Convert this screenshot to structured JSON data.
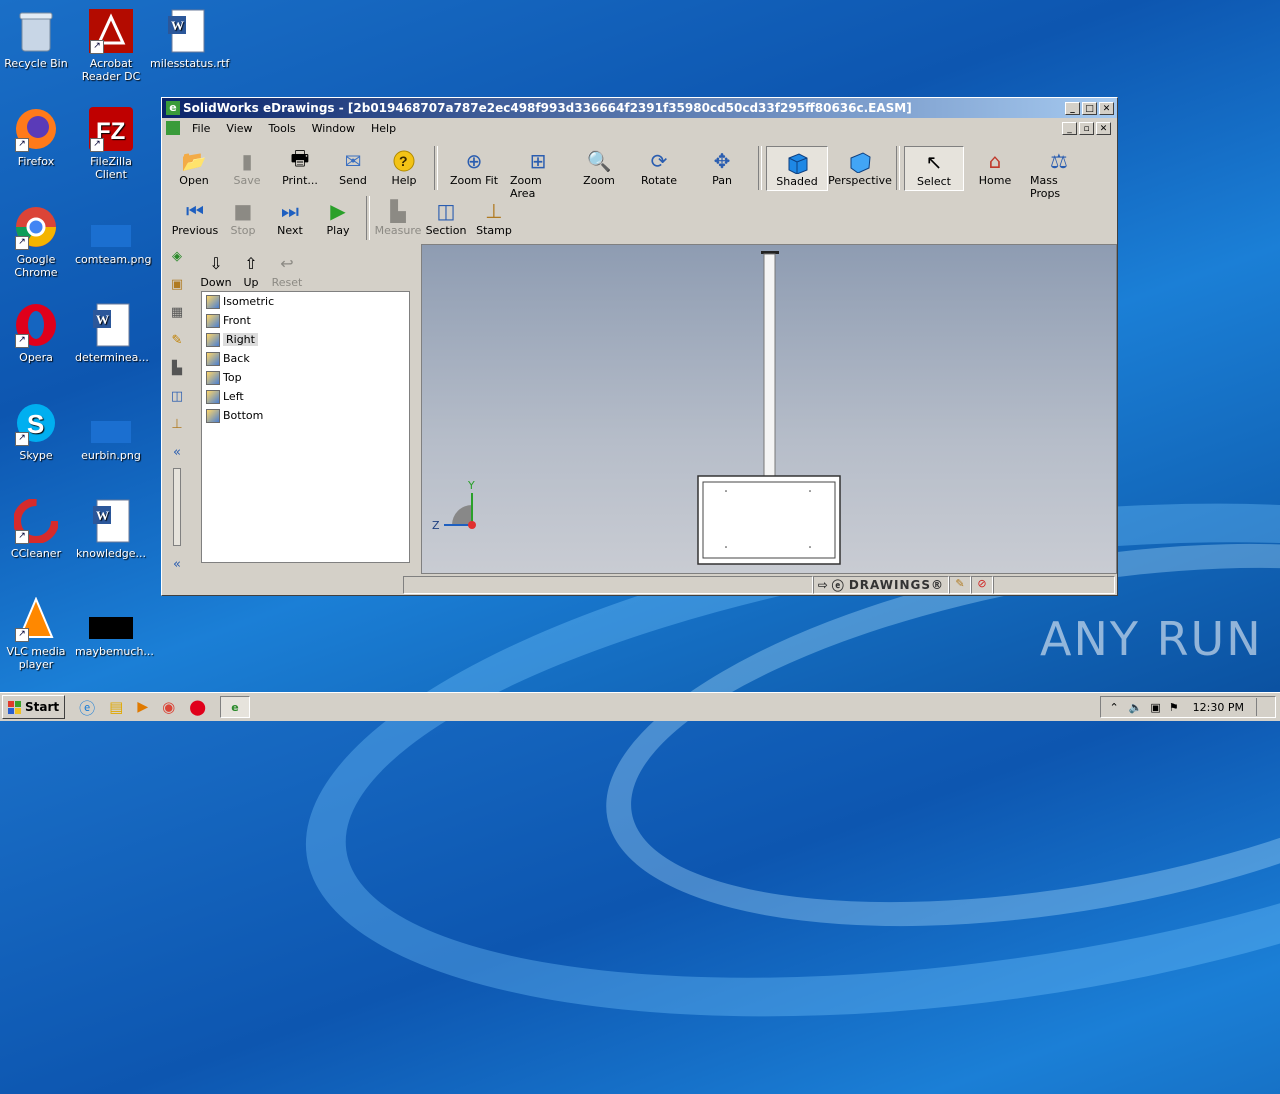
{
  "desktop": {
    "icons": [
      {
        "label": "Recycle Bin"
      },
      {
        "label": "Acrobat Reader DC"
      },
      {
        "label": "milesstatus.rtf"
      },
      {
        "label": "Firefox"
      },
      {
        "label": "FileZilla Client"
      },
      {
        "label": "Google Chrome"
      },
      {
        "label": "comteam.png"
      },
      {
        "label": "Opera"
      },
      {
        "label": "determinea..."
      },
      {
        "label": "Skype"
      },
      {
        "label": "eurbin.png"
      },
      {
        "label": "CCleaner"
      },
      {
        "label": "knowledge..."
      },
      {
        "label": "VLC media player"
      },
      {
        "label": "maybemuch..."
      }
    ],
    "watermark": "ANY RUN"
  },
  "window": {
    "title": "SolidWorks eDrawings - [2b019468707a787e2ec498f993d336664f2391f35980cd50cd33f295ff80636c.EASM]",
    "menu": [
      "File",
      "View",
      "Tools",
      "Window",
      "Help"
    ],
    "toolbar1": [
      "Open",
      "Save",
      "Print...",
      "Send",
      "Help",
      "Zoom Fit",
      "Zoom Area",
      "Zoom",
      "Rotate",
      "Pan",
      "Shaded",
      "Perspective",
      "Select",
      "Home",
      "Mass Props"
    ],
    "toolbar2": [
      "Previous",
      "Stop",
      "Next",
      "Play",
      "Measure",
      "Section",
      "Stamp"
    ],
    "panel_buttons": [
      "Down",
      "Up",
      "Reset"
    ],
    "views": [
      "Isometric",
      "Front",
      "Right",
      "Back",
      "Top",
      "Left",
      "Bottom"
    ],
    "selected_view": "Right",
    "axis": {
      "y": "Y",
      "z": "Z"
    },
    "status_logo": "DRAWINGS®"
  },
  "taskbar": {
    "start": "Start",
    "clock": "12:30 PM"
  },
  "colors": {
    "titlebar": "#0a246a",
    "desktop": "#1565c0"
  }
}
